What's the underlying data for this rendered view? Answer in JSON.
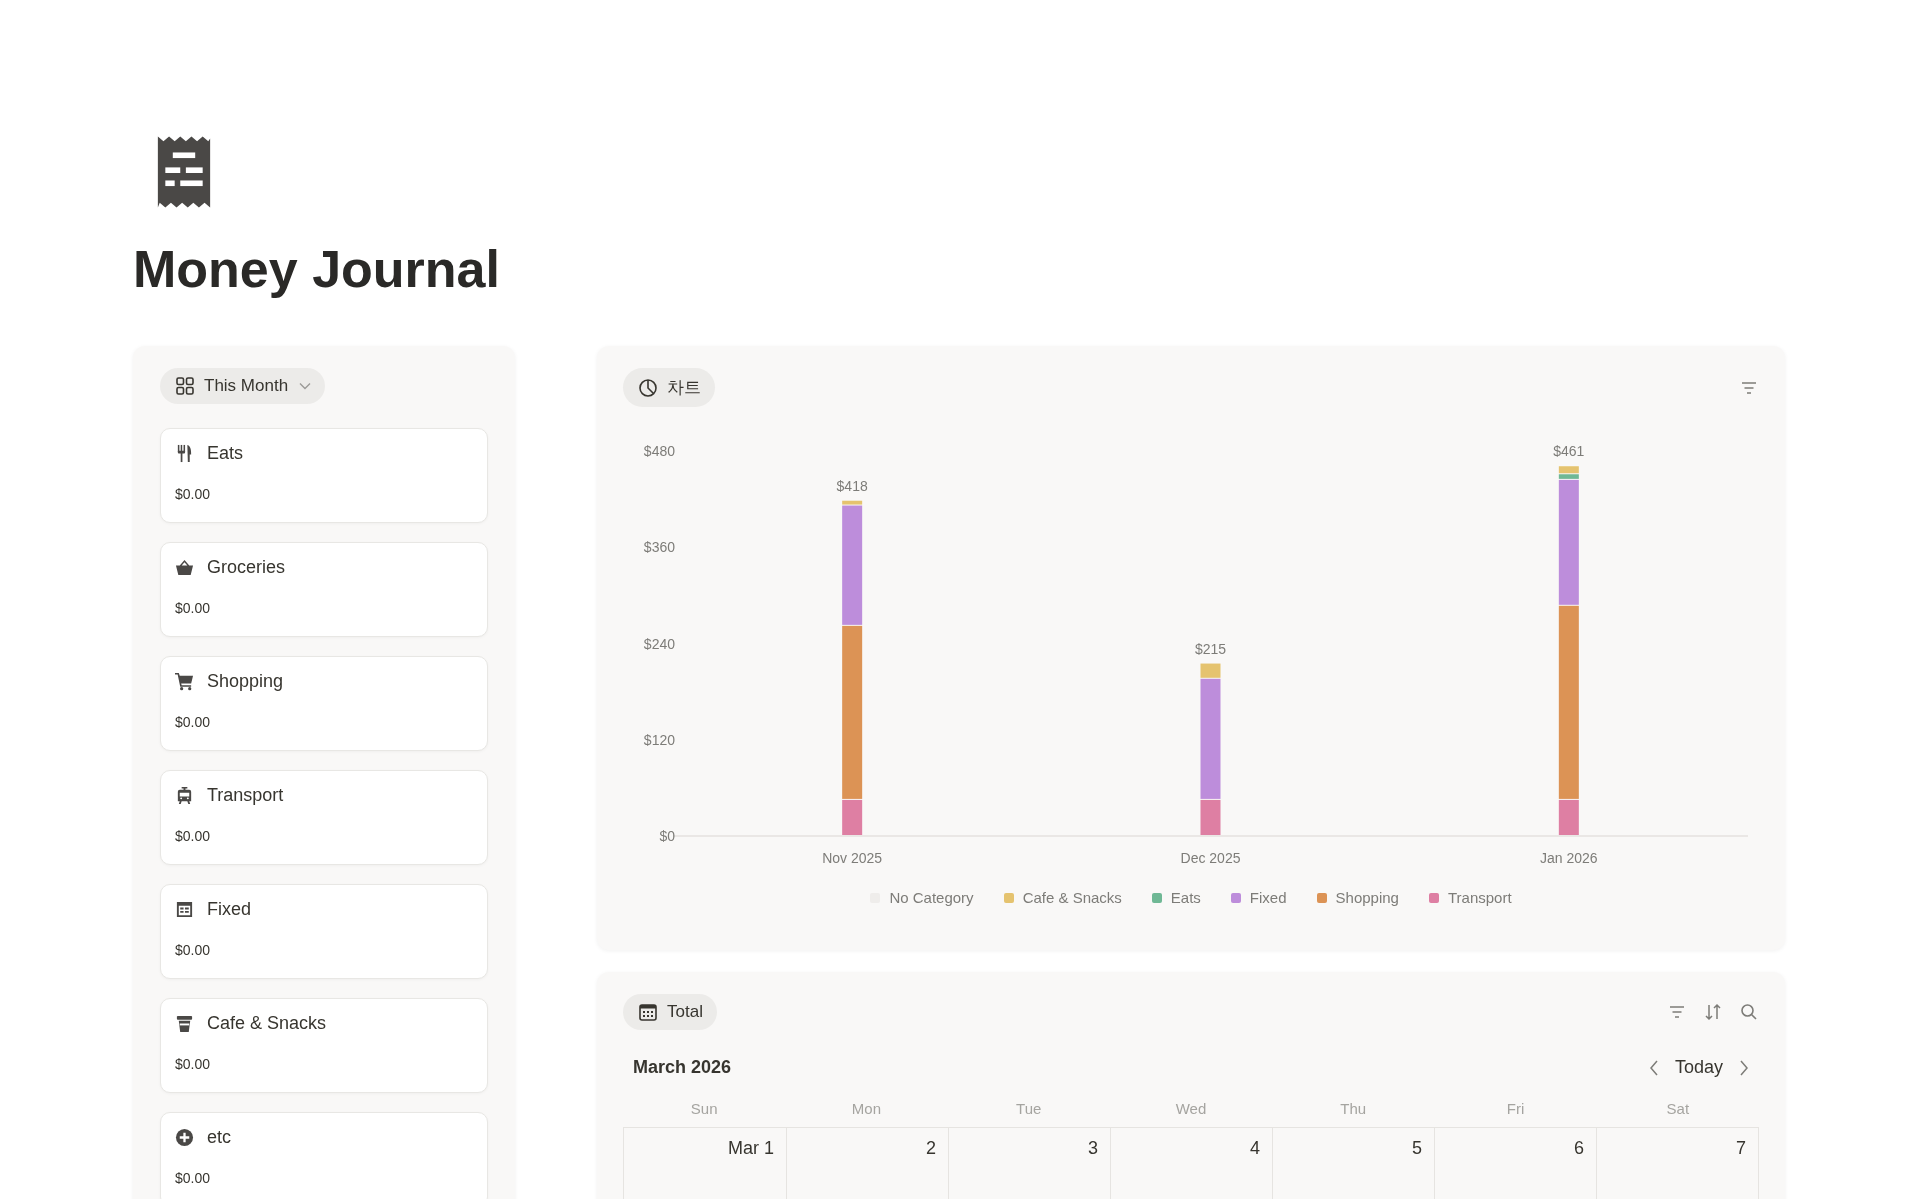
{
  "page": {
    "title": "Money Journal"
  },
  "summary_panel": {
    "view_tab": "This Month",
    "cards": [
      {
        "kind": "eats",
        "name": "Eats",
        "amount": "$0.00"
      },
      {
        "kind": "groceries",
        "name": "Groceries",
        "amount": "$0.00"
      },
      {
        "kind": "shopping",
        "name": "Shopping",
        "amount": "$0.00"
      },
      {
        "kind": "transport",
        "name": "Transport",
        "amount": "$0.00"
      },
      {
        "kind": "fixed",
        "name": "Fixed",
        "amount": "$0.00"
      },
      {
        "kind": "cafe",
        "name": "Cafe & Snacks",
        "amount": "$0.00"
      },
      {
        "kind": "etc",
        "name": "etc",
        "amount": "$0.00"
      }
    ]
  },
  "chart_panel": {
    "view_tab": "차트",
    "chart_data": {
      "type": "bar",
      "stacked": true,
      "categories": [
        "Nov 2025",
        "Dec 2025",
        "Jan 2026"
      ],
      "series": [
        {
          "name": "No Category",
          "color": "#efedeb",
          "values": [
            null,
            null,
            null
          ]
        },
        {
          "name": "Cafe & Snacks",
          "color": "#e5c36f",
          "values": [
            6,
            19,
            10
          ]
        },
        {
          "name": "Eats",
          "color": "#6fb895",
          "values": [
            null,
            null,
            7
          ]
        },
        {
          "name": "Fixed",
          "color": "#bd8ddb",
          "values": [
            150,
            151,
            157
          ]
        },
        {
          "name": "Shopping",
          "color": "#dc9355",
          "values": [
            217,
            null,
            242
          ]
        },
        {
          "name": "Transport",
          "color": "#de7fa3",
          "values": [
            45,
            45,
            45
          ]
        }
      ],
      "ylim": [
        0,
        480
      ],
      "yticks": [
        {
          "value": 0,
          "label": "$0"
        },
        {
          "value": 120,
          "label": "$120"
        },
        {
          "value": 240,
          "label": "$240"
        },
        {
          "value": 360,
          "label": "$360"
        },
        {
          "value": 480,
          "label": "$480"
        }
      ],
      "value_labels": [
        "$418",
        "$215",
        "$461"
      ],
      "legend": "bottom"
    }
  },
  "calendar_panel": {
    "view_tab": "Total",
    "month": "March 2026",
    "today_button": "Today",
    "weekdays": [
      "Sun",
      "Mon",
      "Tue",
      "Wed",
      "Thu",
      "Fri",
      "Sat"
    ],
    "days": [
      "Mar 1",
      "2",
      "3",
      "4",
      "5",
      "6",
      "7"
    ]
  }
}
